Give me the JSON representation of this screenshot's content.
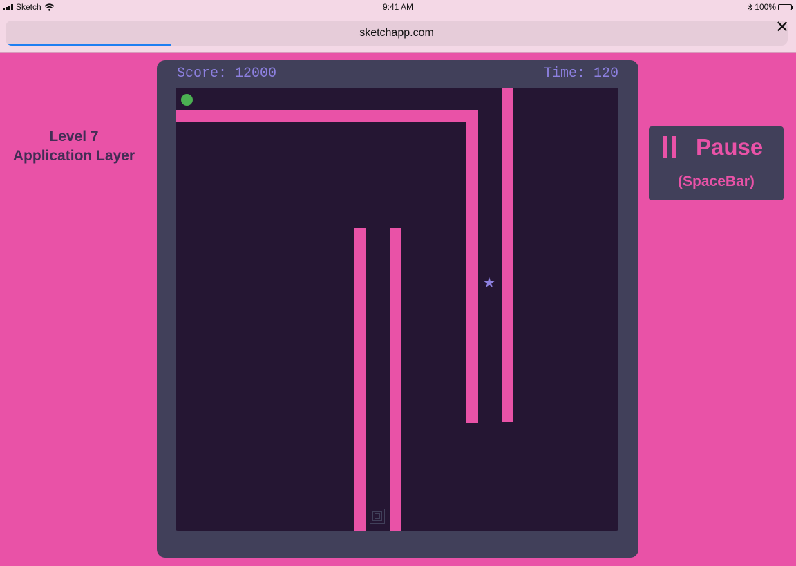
{
  "status_bar": {
    "carrier": "Sketch",
    "time": "9:41 AM",
    "battery": "100%",
    "battery_level": 1.0,
    "icons": [
      "signal-icon",
      "wifi-icon",
      "bluetooth-icon",
      "battery-icon"
    ]
  },
  "browser": {
    "url": "sketchapp.com",
    "load_progress": 0.21,
    "close_icon": "close-icon",
    "close_glyph": "✕"
  },
  "level": {
    "line1": "Level 7",
    "line2": "Application Layer"
  },
  "game": {
    "score": "Score: 12000",
    "time": "Time: 120",
    "player": "green-ball",
    "collectible": "star-icon",
    "star_glyph": "★",
    "goal": "goal-tile"
  },
  "pause": {
    "label": "Pause",
    "hint": "(SpaceBar)",
    "icon": "pause-icon"
  },
  "colors": {
    "background": "#e952a7",
    "panel": "#41405a",
    "board": "#251633",
    "wall": "#e952a7",
    "hud_text": "#8d80e0",
    "level_text": "#432d55",
    "player": "#4bb052",
    "progress": "#1e7ff2"
  }
}
